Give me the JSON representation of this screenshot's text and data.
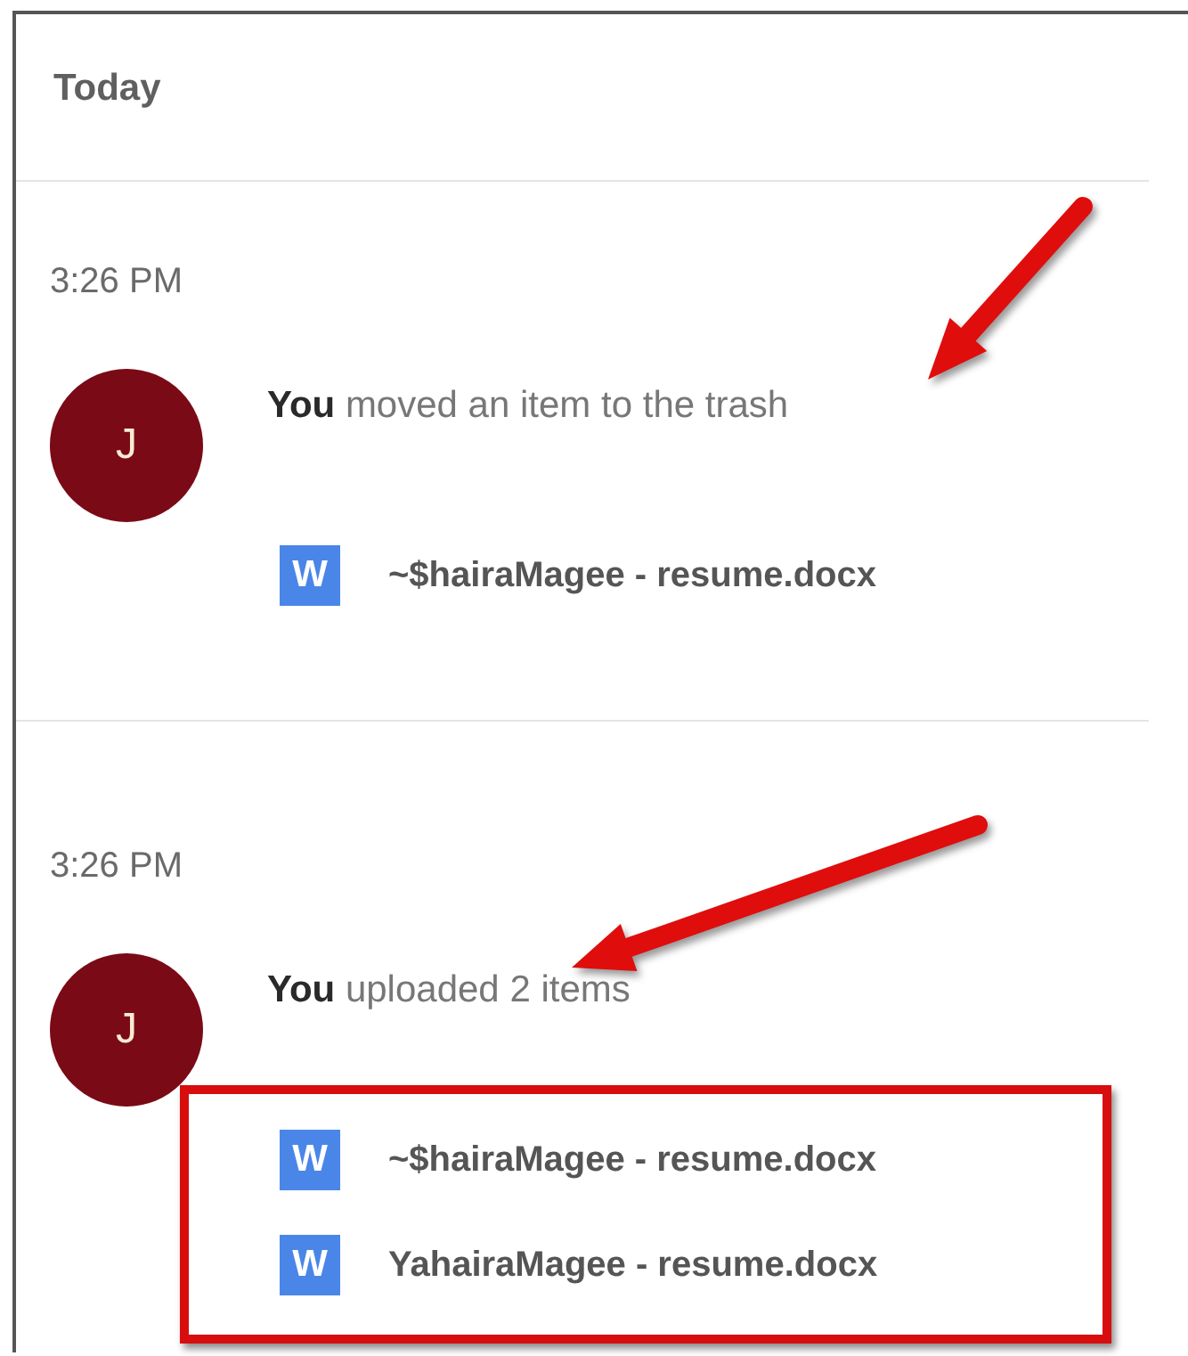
{
  "heading": "Today",
  "activities": [
    {
      "time": "3:26 PM",
      "avatar": "J",
      "text": "**You** moved an item to the trash",
      "arrow": true,
      "highlighted": false,
      "files": [
        {
          "icon": "W",
          "name": "~$hairaMagee - resume.docx"
        }
      ]
    },
    {
      "time": "3:26 PM",
      "avatar": "J",
      "text": "**You** uploaded 2 items",
      "arrow": true,
      "highlighted": true,
      "files": [
        {
          "icon": "W",
          "name": "~$hairaMagee - resume.docx"
        },
        {
          "icon": "W",
          "name": "YahairaMagee - resume.docx"
        }
      ]
    }
  ]
}
